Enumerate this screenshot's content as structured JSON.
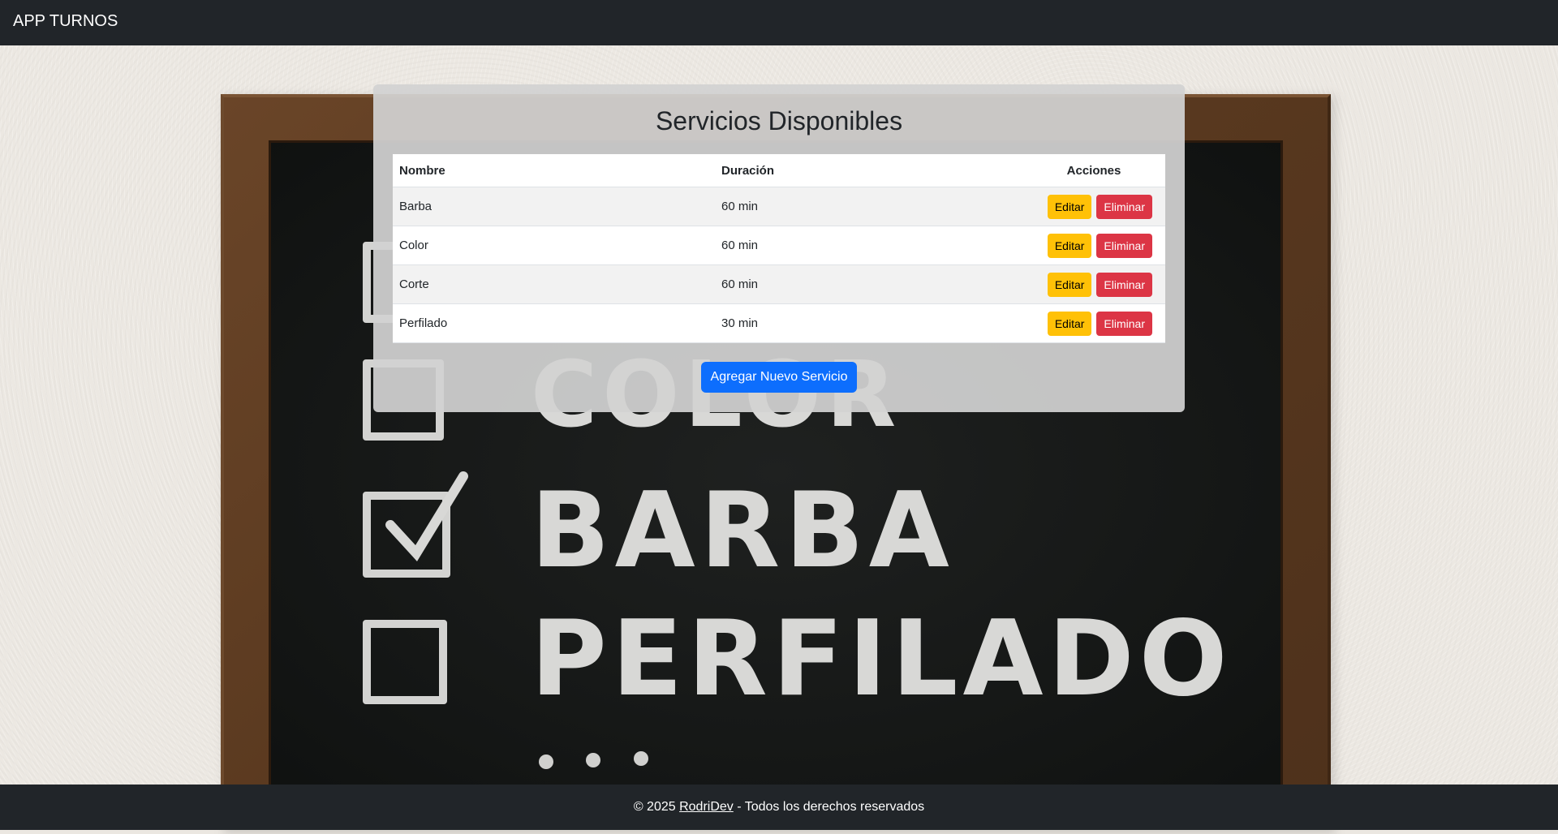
{
  "navbar": {
    "brand": "APP TURNOS"
  },
  "chalkboard": {
    "words": [
      "COLOR",
      "BARBA",
      "PERFILADO"
    ],
    "dots": "• • •"
  },
  "card": {
    "title": "Servicios Disponibles",
    "table": {
      "headers": {
        "name": "Nombre",
        "duration": "Duración",
        "actions": "Acciones"
      },
      "rows": [
        {
          "name": "Barba",
          "duration": "60 min"
        },
        {
          "name": "Color",
          "duration": "60 min"
        },
        {
          "name": "Corte",
          "duration": "60 min"
        },
        {
          "name": "Perfilado",
          "duration": "30 min"
        }
      ],
      "edit_label": "Editar",
      "delete_label": "Eliminar"
    },
    "add_button": "Agregar Nuevo Servicio"
  },
  "footer": {
    "prefix": "© 2025",
    "link": "RodriDev",
    "suffix": "- Todos los derechos reservados"
  },
  "colors": {
    "navbar": "#212529",
    "primary": "#0d6efd",
    "warning": "#ffc107",
    "danger": "#dc3545"
  }
}
